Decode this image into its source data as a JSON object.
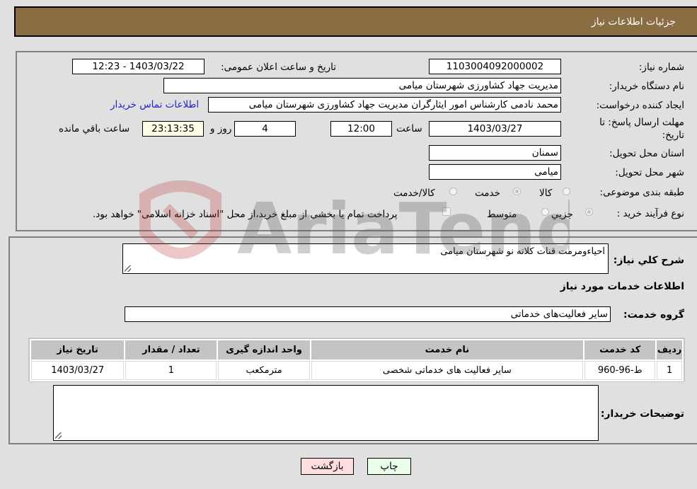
{
  "header": {
    "title": "جزئیات اطلاعات نیاز"
  },
  "details": {
    "need_number": {
      "label": "شماره نیاز:",
      "value": "1103004092000002"
    },
    "announce_datetime": {
      "label": "تاریخ و ساعت اعلان عمومی:",
      "value": "1403/03/22 - 12:23"
    },
    "buyer_org": {
      "label": "نام دستگاه خریدار:",
      "value": "مدیریت جهاد کشاورزی شهرستان میامی"
    },
    "requester": {
      "label": "ایجاد کننده درخواست:",
      "value": "محمد نادمی کارشناس امور ایثارگران مدیریت جهاد کشاورزی شهرستان میامی"
    },
    "buyer_contact_link": "اطلاعات تماس خریدار",
    "deadline": {
      "label_line1": "مهلت ارسال پاسخ: تا",
      "label_line2": "تاریخ:",
      "date": "1403/03/27",
      "time_label": "ساعت",
      "time": "12:00",
      "days": "4",
      "days_label": "روز و",
      "remaining": "23:13:35",
      "remaining_label": "ساعت باقي مانده"
    },
    "province": {
      "label": "استان محل تحویل:",
      "value": "سمنان"
    },
    "city": {
      "label": "شهر محل تحویل:",
      "value": "میامی"
    },
    "category": {
      "label": "طبقه بندی موضوعی:",
      "options": [
        "کالا",
        "خدمت",
        "کالا/خدمت"
      ],
      "selected": "خدمت"
    },
    "purchase_type": {
      "label": "نوع فرآیند خرید :",
      "options": [
        "جزيي",
        "متوسط"
      ],
      "selected": "جزيي",
      "treasury_note": "پرداخت تمام یا بخشی از مبلغ خرید،از محل \"اسناد خزانه اسلامی\" خواهد بود.",
      "treasury_checked": false
    }
  },
  "summary": {
    "label": "شرح کلي نياز:",
    "value": "احیاءومرمت قنات کلاته نو شهرستان میامی"
  },
  "services_info_title": "اطلاعات خدمات مورد نیاز",
  "service_group": {
    "label": "گروه خدمت:",
    "value": "سایر فعالیت‌های خدماتی"
  },
  "services_table": {
    "columns": [
      "ردیف",
      "کد خدمت",
      "نام خدمت",
      "واحد اندازه گیری",
      "تعداد / مقدار",
      "تاریخ نیاز"
    ],
    "rows": [
      [
        "1",
        "ط-96-960",
        "سایر فعالیت های خدماتی شخصی",
        "مترمکعب",
        "1",
        "1403/03/27"
      ]
    ]
  },
  "buyer_notes": {
    "label": "توضیحات خریدار:",
    "value": ""
  },
  "buttons": {
    "print": "چاپ",
    "back": "بازگشت"
  },
  "colors": {
    "header_bg": "#8b6d44",
    "print_bg": "#eaffea",
    "back_bg": "#ffdede",
    "link": "#2222cc"
  },
  "watermark": "AriaTender.neT"
}
